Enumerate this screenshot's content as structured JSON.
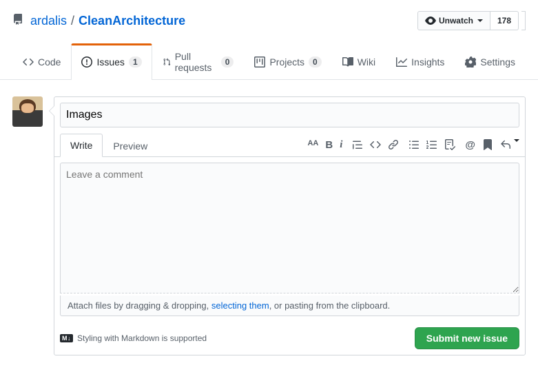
{
  "breadcrumb": {
    "owner": "ardalis",
    "separator": "/",
    "repo": "CleanArchitecture"
  },
  "watch": {
    "label": "Unwatch",
    "count": "178"
  },
  "tabs": {
    "code": "Code",
    "issues": {
      "label": "Issues",
      "count": "1"
    },
    "pulls": {
      "label": "Pull requests",
      "count": "0"
    },
    "projects": {
      "label": "Projects",
      "count": "0"
    },
    "wiki": "Wiki",
    "insights": "Insights",
    "settings": "Settings"
  },
  "issue": {
    "title_value": "Images",
    "comment_tabs": {
      "write": "Write",
      "preview": "Preview"
    },
    "body_value": "",
    "body_placeholder": "Leave a comment",
    "attach_prefix": "Attach files by dragging & dropping, ",
    "attach_link": "selecting them",
    "attach_suffix": ", or pasting from the clipboard.",
    "md_hint": "Styling with Markdown is supported",
    "submit": "Submit new issue"
  },
  "toolbar_icons": {
    "heading": "AA",
    "bold": "B",
    "italic": "i",
    "quote": "quote-icon",
    "code": "code-icon",
    "link": "link-icon",
    "ul": "list-unordered-icon",
    "ol": "list-ordered-icon",
    "task": "tasklist-icon",
    "mention": "@",
    "bookmark": "bookmark-icon",
    "reply": "reply-icon"
  }
}
